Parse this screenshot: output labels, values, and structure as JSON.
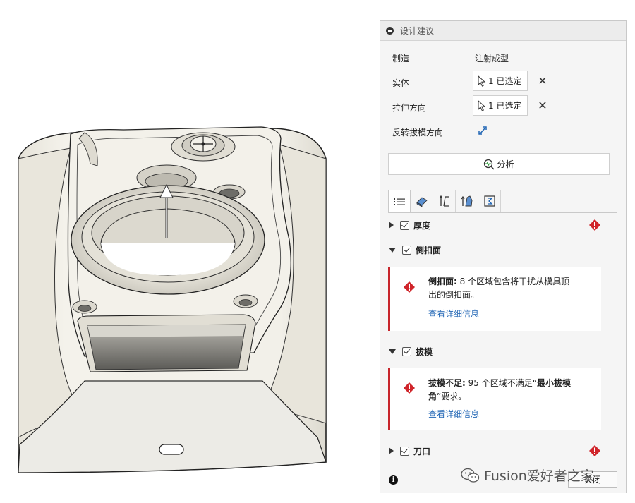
{
  "panel": {
    "title": "设计建议",
    "manufacturing_label": "制造",
    "manufacturing_value": "注射成型",
    "body_label": "实体",
    "body_selected": "1 已选定",
    "pull_label": "拉伸方向",
    "pull_selected": "1 已选定",
    "flip_label": "反转拔模方向",
    "analyze_label": "分析"
  },
  "tabs": [
    {
      "icon": "list-icon"
    },
    {
      "icon": "eraser-icon"
    },
    {
      "icon": "draft-angle-icon"
    },
    {
      "icon": "thickness-icon"
    },
    {
      "icon": "undercut-icon"
    }
  ],
  "sections": {
    "thickness": {
      "label": "厚度",
      "expanded": false,
      "status": "error"
    },
    "undercut": {
      "label": "倒扣面",
      "expanded": true,
      "message_bold": "倒扣面:",
      "message_line1": " 8 个区域包含将干扰从模具顶",
      "message_line2": "出的倒扣面。",
      "link": "查看详细信息"
    },
    "draft": {
      "label": "拔模",
      "expanded": true,
      "message_bold": "拔模不足:",
      "message_line1": " 95 个区域不满足“",
      "message_bold2": "最小拔模",
      "message_bold3": "角",
      "message_line2": "”要求。",
      "link": "查看详细信息"
    },
    "knife_edge": {
      "label": "刀口",
      "expanded": false,
      "status": "error"
    }
  },
  "footer": {
    "close_label": "关闭",
    "info_icon": "i"
  },
  "watermark": "Fusion爱好者之家",
  "colors": {
    "error_red": "#d0252b",
    "link_blue": "#2166b5",
    "part_fill": "#efede6"
  }
}
